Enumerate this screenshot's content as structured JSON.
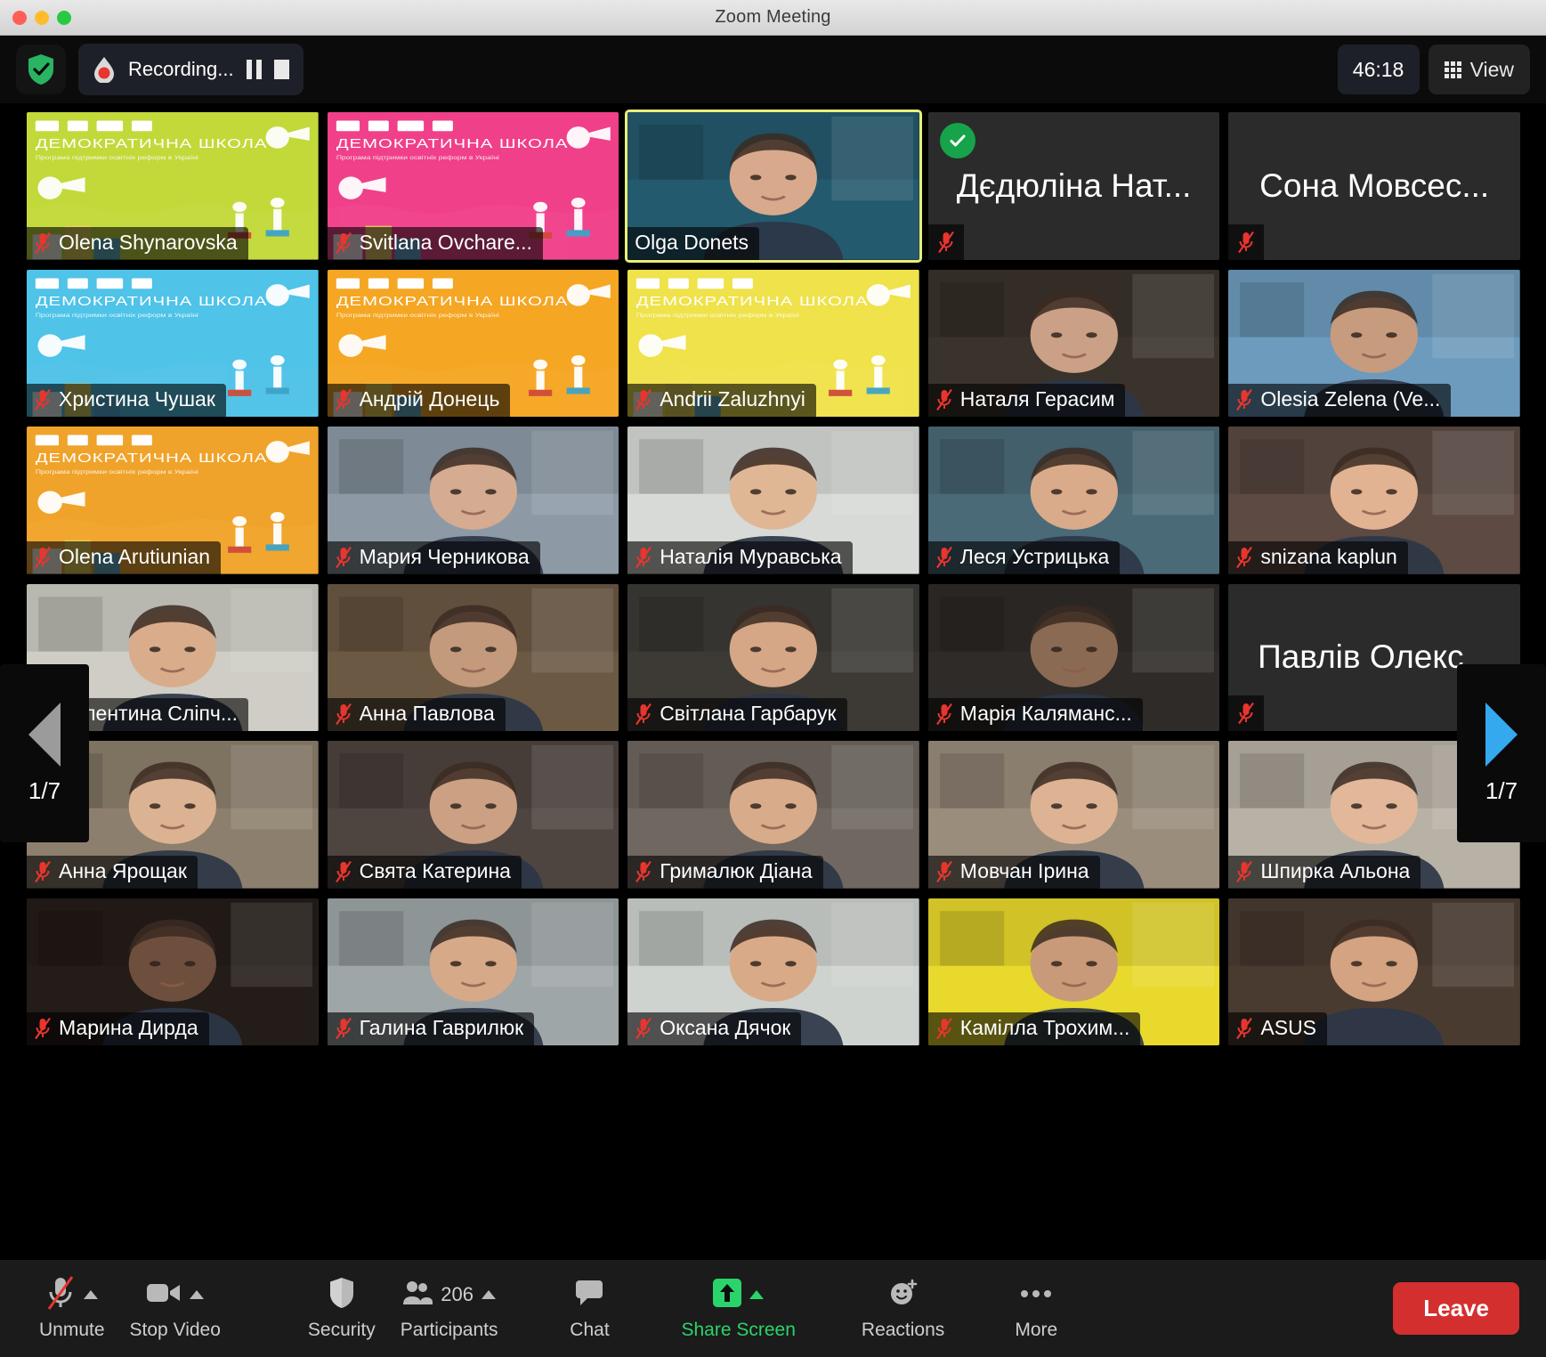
{
  "window": {
    "title": "Zoom Meeting",
    "traffic_lights": [
      "close",
      "minimize",
      "maximize"
    ]
  },
  "topbar": {
    "shield_icon": "shield-check-icon",
    "recording_icon": "recording-dot-icon",
    "recording_label": "Recording...",
    "pause_icon": "pause-icon",
    "stop_icon": "stop-icon",
    "timer": "46:18",
    "view_icon": "grid-icon",
    "view_label": "View"
  },
  "gallery": {
    "pager_left": {
      "icon": "triangle-left-icon",
      "label": "1/7"
    },
    "pager_right": {
      "icon": "triangle-right-icon",
      "label": "1/7"
    },
    "mic_off_icon": "mic-off-icon",
    "host_check_icon": "check-circle-icon",
    "tiles": [
      {
        "name": "Olena Shynarovska",
        "video": true,
        "muted": true,
        "active": false,
        "bg": "democratic-green"
      },
      {
        "name": "Svitlana Ovchare...",
        "video": true,
        "muted": true,
        "active": false,
        "bg": "democratic-pink"
      },
      {
        "name": "Olga Donets",
        "video": true,
        "muted": false,
        "active": true,
        "bg": "teal-room"
      },
      {
        "name": "Дєдюліна Нат...",
        "video": false,
        "muted": true,
        "active": false,
        "host": true
      },
      {
        "name": "Сона Мовсес...",
        "video": false,
        "muted": true,
        "active": false
      },
      {
        "name": "Христина Чушак",
        "video": true,
        "muted": true,
        "active": false,
        "bg": "democratic-blue"
      },
      {
        "name": "Андрій Донець",
        "video": true,
        "muted": true,
        "active": false,
        "bg": "democratic-orange"
      },
      {
        "name": "Andrii Zaluzhnyi",
        "video": true,
        "muted": true,
        "active": false,
        "bg": "democratic-yellow"
      },
      {
        "name": "Наталя Герасим",
        "video": true,
        "muted": true,
        "active": false,
        "bg": "room-dark"
      },
      {
        "name": "Olesia Zelena (Ve...",
        "video": true,
        "muted": true,
        "active": false,
        "bg": "bedroom-blue"
      },
      {
        "name": "Olena Arutiunian",
        "video": true,
        "muted": true,
        "active": false,
        "bg": "democratic-orange2"
      },
      {
        "name": "Мария Черникова",
        "video": true,
        "muted": true,
        "active": false,
        "bg": "room-grey"
      },
      {
        "name": "Наталія Муравська",
        "video": true,
        "muted": true,
        "active": false,
        "bg": "room-white"
      },
      {
        "name": "Леся Устрицька",
        "video": true,
        "muted": true,
        "active": false,
        "bg": "room-teal"
      },
      {
        "name": "snizana kaplun",
        "video": true,
        "muted": true,
        "active": false,
        "bg": "room-warm"
      },
      {
        "name": "Валентина Сліпч...",
        "video": true,
        "muted": true,
        "active": false,
        "bg": "room-pale"
      },
      {
        "name": "Анна Павлова",
        "video": true,
        "muted": true,
        "active": false,
        "bg": "room-cabinet"
      },
      {
        "name": "Світлана Гарбарук",
        "video": true,
        "muted": true,
        "active": false,
        "bg": "room-plant"
      },
      {
        "name": "Марія Каляманс...",
        "video": true,
        "muted": true,
        "active": false,
        "bg": "room-curtain"
      },
      {
        "name": "Павлів Олекс...",
        "video": false,
        "muted": true,
        "active": false
      },
      {
        "name": "Анна Ярощак",
        "video": true,
        "muted": true,
        "active": false,
        "bg": "room-office"
      },
      {
        "name": "Свята Катерина",
        "video": true,
        "muted": true,
        "active": false,
        "bg": "room-dim"
      },
      {
        "name": "Грималюк Діана",
        "video": true,
        "muted": true,
        "active": false,
        "bg": "room-two"
      },
      {
        "name": "Мовчан Ірина",
        "video": true,
        "muted": true,
        "active": false,
        "bg": "room-sofa"
      },
      {
        "name": "Шпирка Альона",
        "video": true,
        "muted": true,
        "active": false,
        "bg": "room-window"
      },
      {
        "name": "Марина Дирда",
        "video": true,
        "muted": true,
        "active": false,
        "bg": "room-night"
      },
      {
        "name": "Галина Гаврилюк",
        "video": true,
        "muted": true,
        "active": false,
        "bg": "room-blinds"
      },
      {
        "name": "Оксана Дячок",
        "video": true,
        "muted": true,
        "active": false,
        "bg": "room-glasses"
      },
      {
        "name": "Камілла Трохим...",
        "video": true,
        "muted": true,
        "active": false,
        "bg": "room-yellow"
      },
      {
        "name": "ASUS",
        "video": true,
        "muted": true,
        "active": false,
        "bg": "room-shelf"
      }
    ]
  },
  "toolbar": {
    "items": [
      {
        "label": "Unmute",
        "icon": "mic-off-icon",
        "caret": true,
        "accent": false
      },
      {
        "label": "Stop Video",
        "icon": "video-camera-icon",
        "caret": true,
        "accent": false
      },
      {
        "label": "Security",
        "icon": "shield-icon",
        "caret": false,
        "accent": false
      },
      {
        "label": "Participants",
        "icon": "participants-icon",
        "caret": true,
        "accent": false,
        "count": "206"
      },
      {
        "label": "Chat",
        "icon": "chat-bubble-icon",
        "caret": false,
        "accent": false
      },
      {
        "label": "Share Screen",
        "icon": "share-screen-icon",
        "caret": true,
        "accent": true
      },
      {
        "label": "Reactions",
        "icon": "reactions-icon",
        "caret": false,
        "accent": false
      },
      {
        "label": "More",
        "icon": "ellipsis-icon",
        "caret": false,
        "accent": false
      }
    ],
    "leave_label": "Leave"
  },
  "colors": {
    "accent_green": "#2bd46a",
    "leave_red": "#d32f2f",
    "active_speaker": "#e9ef7a",
    "host_badge": "#16a34a",
    "mic_red": "#e8352e",
    "pager_right": "#34a9ed"
  }
}
